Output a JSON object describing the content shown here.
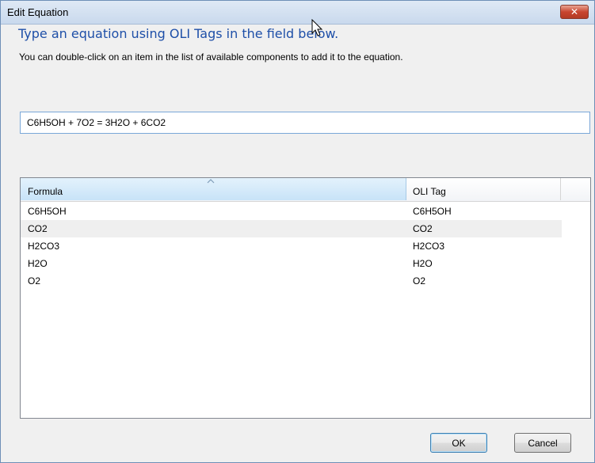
{
  "window": {
    "title": "Edit Equation",
    "close_symbol": "✕",
    "close_color": "#c8452f"
  },
  "heading": "Type an equation using OLI Tags in the field below.",
  "instructions": "You can double-click on an item in the list of available components to add it to the equation.",
  "equation": {
    "value": "C6H5OH + 7O2 = 3H2O + 6CO2"
  },
  "list": {
    "columns": [
      "Formula",
      "OLI Tag"
    ],
    "sorted_column": "Formula",
    "rows": [
      {
        "formula": "C6H5OH",
        "tag": "C6H5OH"
      },
      {
        "formula": "CO2",
        "tag": "CO2"
      },
      {
        "formula": "H2CO3",
        "tag": "H2CO3"
      },
      {
        "formula": "H2O",
        "tag": "H2O"
      },
      {
        "formula": "O2",
        "tag": "O2"
      }
    ]
  },
  "buttons": {
    "ok": "OK",
    "cancel": "Cancel"
  },
  "colors": {
    "accent": "#1e4fa8",
    "selected_header": "#c8e3f8",
    "input_border": "#7aa7d8"
  }
}
